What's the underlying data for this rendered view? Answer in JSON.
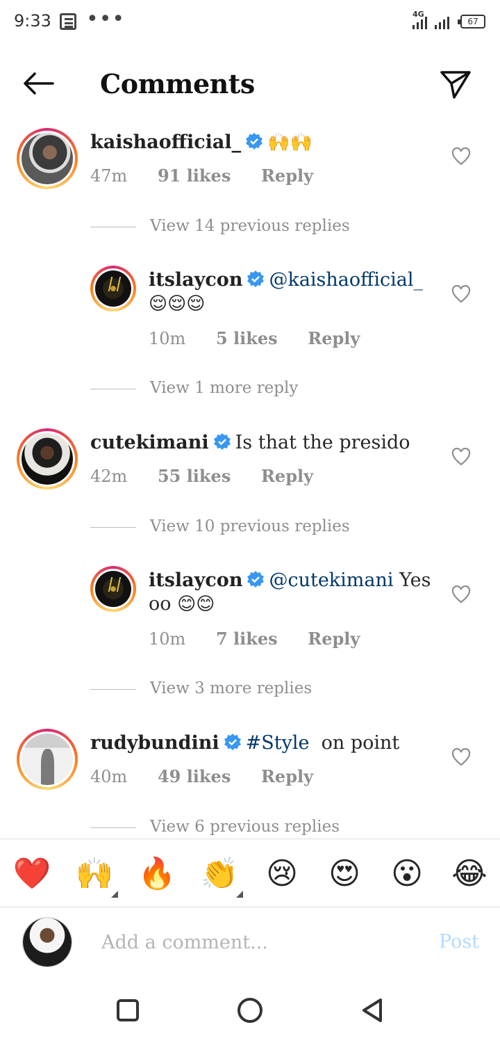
{
  "status_bar": {
    "time": "9:33",
    "dots": "•••",
    "network": "4G",
    "battery": "67"
  },
  "header": {
    "title": "Comments"
  },
  "comments": [
    {
      "username": "kaishaofficial_",
      "text": "",
      "emojis": "🙌🙌",
      "time": "47m",
      "likes": "91 likes",
      "reply": "Reply",
      "view_replies": "View 14 previous replies"
    },
    {
      "username": "itslaycon",
      "mention": "@kaishaofficial_",
      "text": "",
      "emojis": "😌😌😌",
      "time": "10m",
      "likes": "5 likes",
      "reply": "Reply",
      "view_replies": "View 1 more reply"
    },
    {
      "username": "cutekimani",
      "text": "Is that the presido",
      "time": "42m",
      "likes": "55 likes",
      "reply": "Reply",
      "view_replies": "View 10 previous replies"
    },
    {
      "username": "itslaycon",
      "mention": "@cutekimani",
      "text": "Yes",
      "text2": "oo",
      "emojis": "😊😊",
      "time": "10m",
      "likes": "7 likes",
      "reply": "Reply",
      "view_replies": "View 3 more replies"
    },
    {
      "username": "rudybundini",
      "hashtag": "#Style",
      "text": "on point",
      "time": "40m",
      "likes": "49 likes",
      "reply": "Reply",
      "view_replies": "View 6 previous replies"
    }
  ],
  "emoji_bar": [
    "❤️",
    "🙌",
    "🔥",
    "👏",
    "😢",
    "😍",
    "😮",
    "😂"
  ],
  "composer": {
    "placeholder": "Add a comment...",
    "post_label": "Post"
  },
  "colors": {
    "link": "#00376b",
    "meta": "#8e8e8e",
    "post_disabled": "#b3dbff",
    "verified": "#3897f0"
  }
}
